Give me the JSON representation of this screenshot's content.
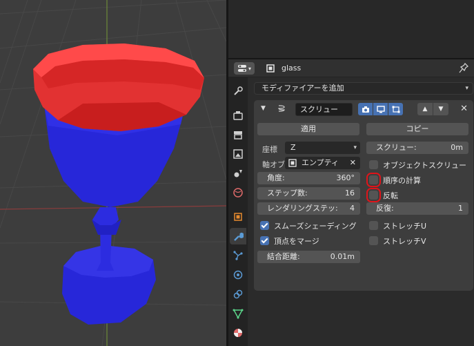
{
  "header": {
    "object_name": "glass"
  },
  "modifier_menu": {
    "add_label": "モディファイアーを追加"
  },
  "modifier": {
    "name": "スクリュー",
    "apply_label": "適用",
    "copy_label": "コピー",
    "axis_label": "座標",
    "axis_value": "Z",
    "axis_object_label": "軸オブ",
    "axis_object_value": "エンプティ",
    "angle_label": "角度:",
    "angle_value": "360°",
    "steps_label": "ステップ数:",
    "steps_value": "16",
    "render_steps_label": "レンダリングステッ:",
    "render_steps_value": "4",
    "smooth_label": "スムーズシェーディング",
    "smooth_checked": true,
    "merge_label": "頂点をマージ",
    "merge_checked": true,
    "merge_dist_label": "結合距離:",
    "merge_dist_value": "0.01m",
    "screw_label": "スクリュー:",
    "screw_value": "0m",
    "object_screw_label": "オブジェクトスクリュー",
    "object_screw_checked": false,
    "calc_order_label": "順序の計算",
    "calc_order_checked": false,
    "flip_label": "反転",
    "flip_checked": false,
    "iterations_label": "反復:",
    "iterations_value": "1",
    "stretch_u_label": "ストレッチU",
    "stretch_u_checked": false,
    "stretch_v_label": "ストレッチV",
    "stretch_v_checked": false
  },
  "colors": {
    "accent": "#4772b3",
    "highlight": "#e0141a",
    "glass_top": "#e23232",
    "glass_body": "#2727d9"
  }
}
